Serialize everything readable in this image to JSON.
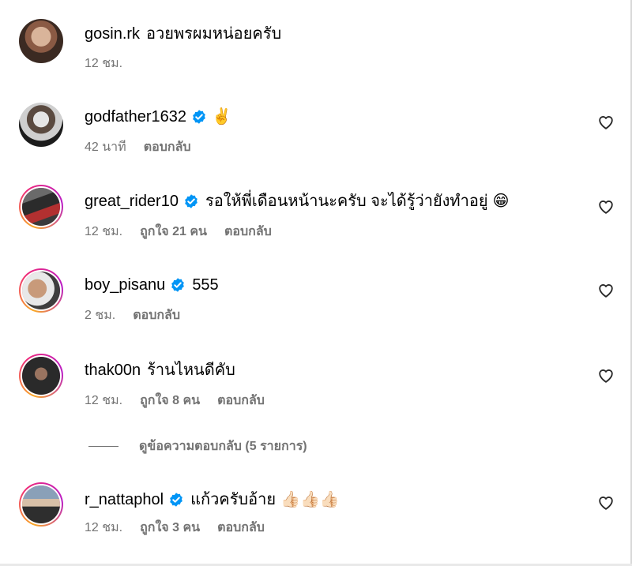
{
  "comments": [
    {
      "username": "gosin.rk",
      "verified": false,
      "text": "อวยพรผมหน่อยครับ",
      "emoji": "",
      "time": "12 ชม.",
      "likes": "",
      "reply": "",
      "has_like_icon": false
    },
    {
      "username": "godfather1632",
      "verified": true,
      "text": "",
      "emoji": "✌️",
      "time": "42 นาที",
      "likes": "",
      "reply": "ตอบกลับ",
      "has_like_icon": true
    },
    {
      "username": "great_rider10",
      "verified": true,
      "text": "รอให้พี่เดือนหน้านะครับ จะได้รู้ว่ายังทำอยู่",
      "emoji": "😁",
      "time": "12 ชม.",
      "likes": "ถูกใจ 21 คน",
      "reply": "ตอบกลับ",
      "has_like_icon": true
    },
    {
      "username": "boy_pisanu",
      "verified": true,
      "text": "555",
      "emoji": "",
      "time": "2 ชม.",
      "likes": "",
      "reply": "ตอบกลับ",
      "has_like_icon": true
    },
    {
      "username": "thak00n",
      "verified": false,
      "text": "ร้านไหนดีคับ",
      "emoji": "",
      "time": "12 ชม.",
      "likes": "ถูกใจ 8 คน",
      "reply": "ตอบกลับ",
      "has_like_icon": true
    },
    {
      "username": "r_nattaphol",
      "verified": true,
      "text": "แก้วครับอ้าย",
      "emoji": "👍🏻👍🏻👍🏻",
      "time": "12 ชม.",
      "likes": "ถูกใจ 3 คน",
      "reply": "ตอบกลับ",
      "has_like_icon": true
    }
  ],
  "view_replies": "ดูข้อความตอบกลับ (5 รายการ)",
  "colors": {
    "verified": "#0095f6",
    "muted": "#737373",
    "text": "#000000"
  },
  "icons": {
    "verified": "verified-badge-icon",
    "like": "heart-outline-icon"
  }
}
